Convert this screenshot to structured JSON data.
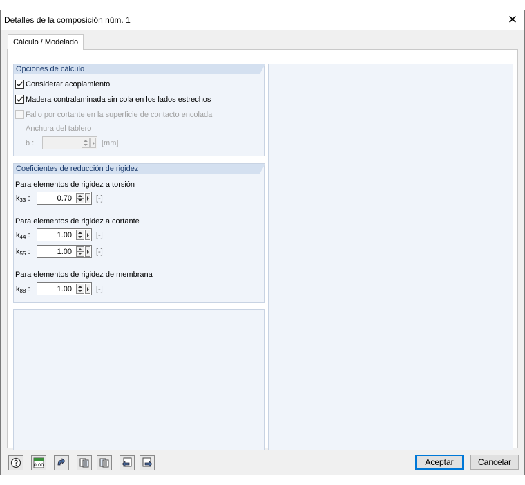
{
  "window": {
    "title": "Detalles de la composición núm. 1",
    "close_glyph": "✕"
  },
  "tabs": [
    {
      "label": "Cálculo / Modelado",
      "active": true
    }
  ],
  "calc_options": {
    "header": "Opciones de cálculo",
    "coupling": {
      "label": "Considerar acoplamiento",
      "checked": true
    },
    "clt_no_glue": {
      "label": "Madera contralaminada sin cola en los lados estrechos",
      "checked": true
    },
    "shear_failure": {
      "label": "Fallo por cortante en la superficie de contacto encolada",
      "checked": false,
      "disabled": true
    },
    "board_width_label": "Anchura del tablero",
    "b_label": "b :",
    "b_value": "",
    "b_unit": "[mm]"
  },
  "stiffness": {
    "header": "Coeficientes de reducción de rigidez",
    "torsion": {
      "label": "Para elementos de rigidez a torsión",
      "k33": {
        "sym": "k",
        "sub": "33",
        "colon": " :",
        "value": "0.70",
        "unit": "[-]"
      }
    },
    "shear": {
      "label": "Para elementos de rigidez a cortante",
      "k44": {
        "sym": "k",
        "sub": "44",
        "colon": " :",
        "value": "1.00",
        "unit": "[-]"
      },
      "k55": {
        "sym": "k",
        "sub": "55",
        "colon": " :",
        "value": "1.00",
        "unit": "[-]"
      }
    },
    "membrane": {
      "label": "Para elementos de rigidez de membrana",
      "k88": {
        "sym": "k",
        "sub": "88",
        "colon": " :",
        "value": "1.00",
        "unit": "[-]"
      }
    }
  },
  "footer": {
    "tool_icons": [
      "help-icon",
      "units-decimal-icon",
      "rotate-icon",
      "copy-layer-icon",
      "copy-layer-alt-icon",
      "import-icon",
      "export-icon"
    ],
    "units_icon_text": "0.00",
    "ok_label": "Aceptar",
    "cancel_label": "Cancelar"
  },
  "colors": {
    "panel_bg": "#f0f4fa",
    "header_bg": "#d4e0f0",
    "header_text": "#1e3d6e",
    "accent": "#0078d7"
  }
}
